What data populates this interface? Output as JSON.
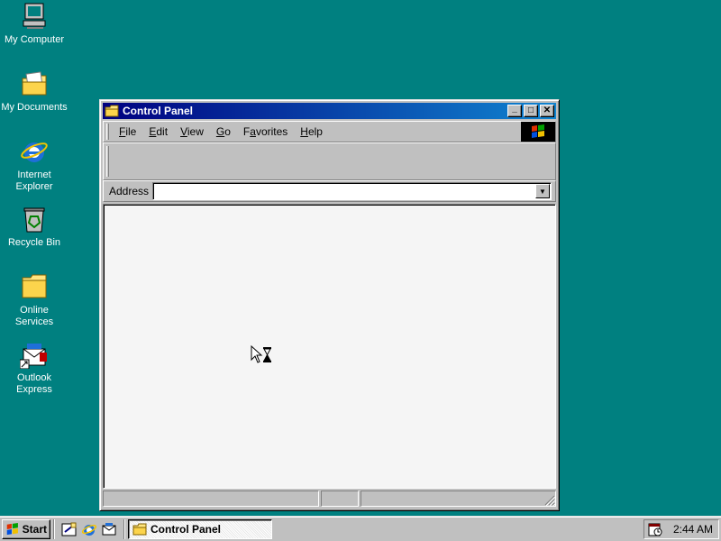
{
  "desktop": {
    "icons": [
      {
        "label": "My Computer",
        "icon": "my-computer-icon"
      },
      {
        "label": "My Documents",
        "icon": "my-documents-icon"
      },
      {
        "label": "Internet Explorer",
        "icon": "internet-explorer-icon"
      },
      {
        "label": "Recycle Bin",
        "icon": "recycle-bin-icon"
      },
      {
        "label": "Online Services",
        "icon": "online-services-icon"
      },
      {
        "label": "Outlook Express",
        "icon": "outlook-express-icon"
      }
    ]
  },
  "window": {
    "title": "Control Panel",
    "menus": [
      {
        "pre": "",
        "u": "F",
        "post": "ile"
      },
      {
        "pre": "",
        "u": "E",
        "post": "dit"
      },
      {
        "pre": "",
        "u": "V",
        "post": "iew"
      },
      {
        "pre": "",
        "u": "G",
        "post": "o"
      },
      {
        "pre": "F",
        "u": "a",
        "post": "vorites"
      },
      {
        "pre": "",
        "u": "H",
        "post": "elp"
      }
    ],
    "address": {
      "label": "Address",
      "value": ""
    },
    "minimize_glyph": "_",
    "maximize_glyph": "□",
    "close_glyph": "✕"
  },
  "taskbar": {
    "start_label": "Start",
    "task_label": "Control Panel",
    "clock": "2:44 AM"
  },
  "colors": {
    "desktop": "#008080",
    "titlebar": "#000080",
    "face": "#c0c0c0"
  }
}
